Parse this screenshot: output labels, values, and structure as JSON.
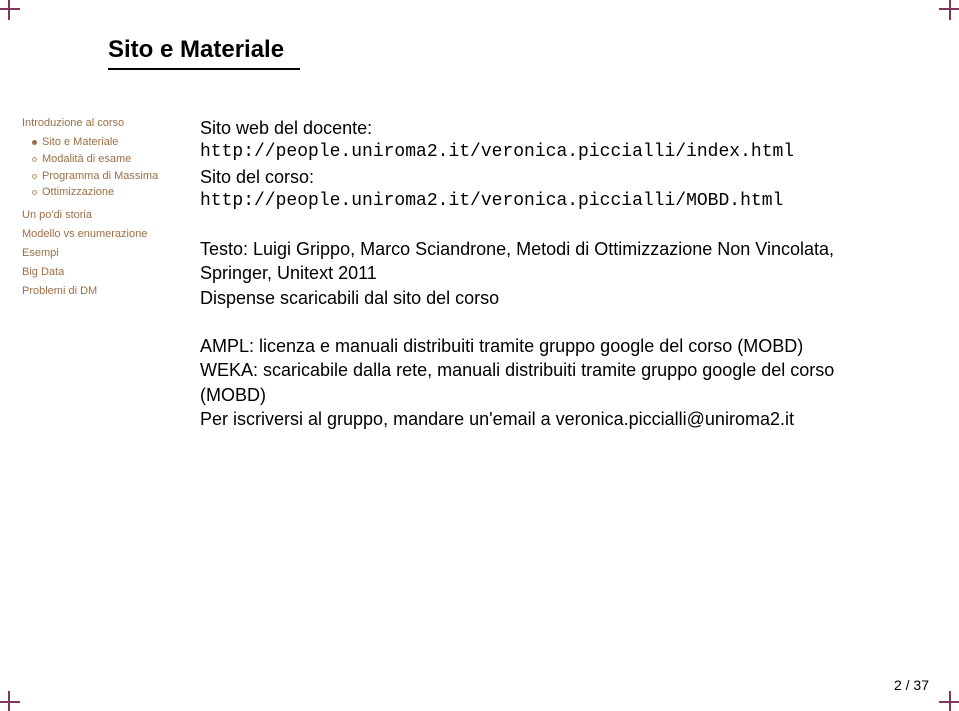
{
  "title": "Sito e Materiale",
  "sidebar": {
    "group1": {
      "head": "Introduzione al corso",
      "items": [
        {
          "label": "Sito e Materiale",
          "active": true
        },
        {
          "label": "Modalità di esame",
          "active": false
        },
        {
          "label": "Programma di Massima",
          "active": false
        },
        {
          "label": "Ottimizzazione",
          "active": false
        }
      ]
    },
    "links": [
      "Un po'di storia",
      "Modello vs enumerazione",
      "Esempi",
      "Big Data",
      "Problemi di DM"
    ]
  },
  "content": {
    "intro1": "Sito web del docente:",
    "url1": "http://people.uniroma2.it/veronica.piccialli/index.html",
    "intro2": "Sito del corso:",
    "url2": "http://people.uniroma2.it/veronica.piccialli/MOBD.html",
    "text1": "Testo: Luigi Grippo, Marco Sciandrone, Metodi di Ottimizzazione Non Vincolata, Springer, Unitext 2011",
    "text2": "Dispense scaricabili dal sito del corso",
    "ampl": "AMPL: licenza e manuali distribuiti tramite gruppo google del corso (MOBD)",
    "weka": "WEKA: scaricabile dalla rete, manuali distribuiti tramite gruppo google del corso (MOBD)",
    "subscribe": "Per iscriversi al gruppo, mandare un'email a veronica.piccialli@uniroma2.it"
  },
  "page": "2 / 37"
}
